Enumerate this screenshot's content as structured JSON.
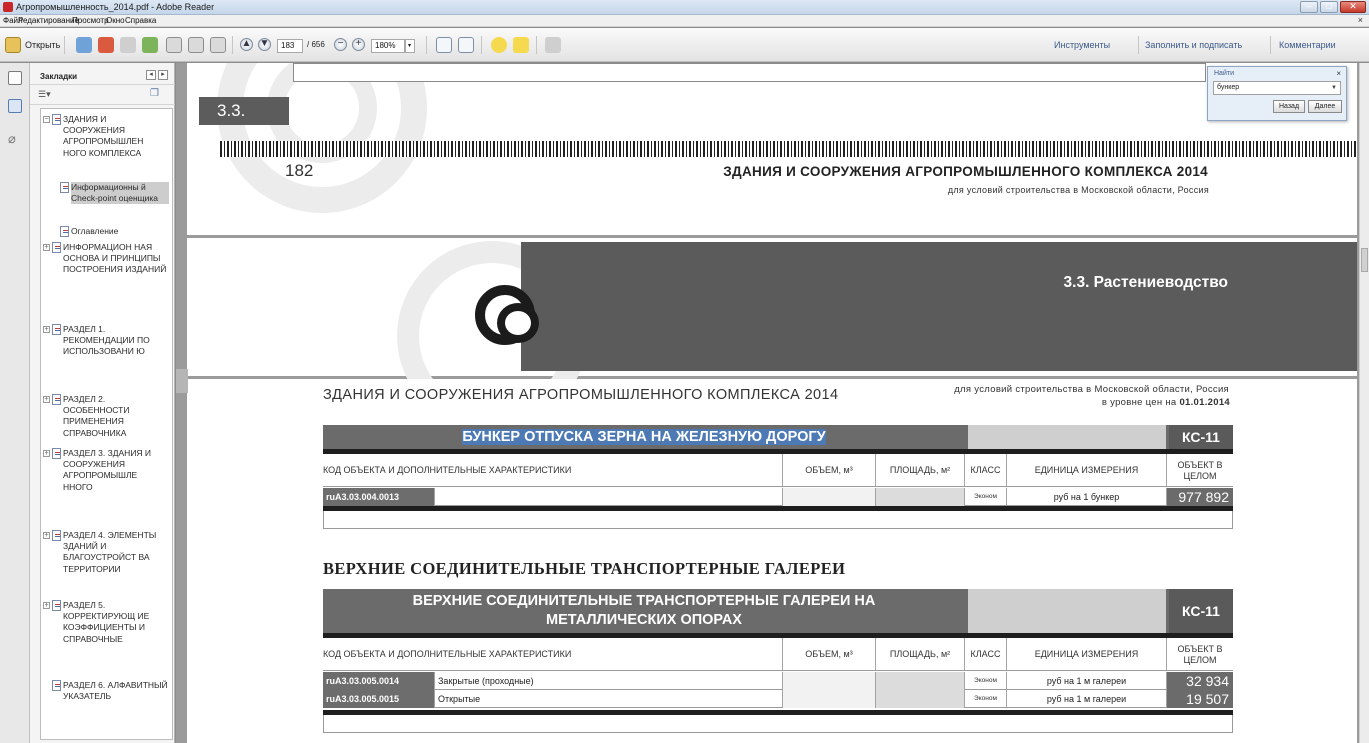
{
  "window": {
    "title": "Агропромышленность_2014.pdf - Adobe Reader"
  },
  "menu": {
    "items": [
      "Файл",
      "Редактирование",
      "Просмотр",
      "Окно",
      "Справка"
    ]
  },
  "toolbar": {
    "open_label": "Открыть",
    "page_current": "183",
    "page_total": "/ 656",
    "zoom": "180%",
    "tools_label": "Инструменты",
    "fill_sign_label": "Заполнить и подписать",
    "comments_label": "Комментарии"
  },
  "bookmarks": {
    "panel_title": "Закладки",
    "items": [
      {
        "label": "ЗДАНИЯ И СООРУЖЕНИЯ АГРОПРОМЫШЛЕН НОГО КОМПЛЕКСА",
        "expander": "−"
      },
      {
        "label": "Информационны й Check-point оценщика",
        "expander": ""
      },
      {
        "label": "Оглавление",
        "expander": ""
      },
      {
        "label": "ИНФОРМАЦИОН НАЯ ОСНОВА И ПРИНЦИПЫ ПОСТРОЕНИЯ ИЗДАНИЙ",
        "expander": "+"
      },
      {
        "label": "РАЗДЕЛ 1. РЕКОМЕНДАЦИИ ПО ИСПОЛЬЗОВАНИ Ю",
        "expander": "+"
      },
      {
        "label": "РАЗДЕЛ 2. ОСОБЕННОСТИ ПРИМЕНЕНИЯ СПРАВОЧНИКА",
        "expander": "+"
      },
      {
        "label": "РАЗДЕЛ 3. ЗДАНИЯ И СООРУЖЕНИЯ АГРОПРОМЫШЛЕ ННОГО",
        "expander": "+"
      },
      {
        "label": "РАЗДЕЛ 4. ЭЛЕМЕНТЫ ЗДАНИЙ И БЛАГОУСТРОЙСТ ВА ТЕРРИТОРИИ",
        "expander": "+"
      },
      {
        "label": "РАЗДЕЛ 5. КОРРЕКТИРУЮЩ ИЕ КОЭФФИЦИЕНТЫ И СПРАВОЧНЫЕ",
        "expander": "+"
      },
      {
        "label": "РАЗДЕЛ 6. АЛФАВИТНЫЙ УКАЗАТЕЛЬ",
        "expander": ""
      }
    ]
  },
  "find": {
    "label": "Найти",
    "value": "бункер",
    "prev_label": "Назад",
    "next_label": "Далее"
  },
  "page1": {
    "section_label": "3.3.",
    "page_number": "182",
    "header_title": "ЗДАНИЯ И СООРУЖЕНИЯ АГРОПРОМЫШЛЕННОГО КОМПЛЕКСА 2014",
    "header_subtitle": "для условий строительства в Московской области, Россия",
    "banner_title": "3.3. Растениеводство"
  },
  "page2": {
    "title": "ЗДАНИЯ И СООРУЖЕНИЯ АГРОПРОМЫШЛЕННОГО КОМПЛЕКСА 2014",
    "subtitle1": "для условий строительства в Московской области, Россия",
    "subtitle2_prefix": "в уровне цен на ",
    "subtitle2_date": "01.01.2014",
    "section_heading": "ВЕРХНИЕ СОЕДИНИТЕЛЬНЫЕ ТРАНСПОРТЕРНЫЕ ГАЛЕРЕИ",
    "columns": {
      "code": "КОД ОБЪЕКТА И ДОПОЛНИТЕЛЬНЫЕ ХАРАКТЕРИСТИКИ",
      "volume": "ОБЪЕМ, м³",
      "area": "ПЛОЩАДЬ, м²",
      "class": "КЛАСС",
      "unit": "ЕДИНИЦА ИЗМЕРЕНИЯ",
      "object": "ОБЪЕКТ В ЦЕЛОМ"
    },
    "table1": {
      "name": "БУНКЕР ОТПУСКА ЗЕРНА НА ЖЕЛЕЗНУЮ ДОРОГУ",
      "code": "КС-11",
      "rows": [
        {
          "code": "ruA3.03.004.0013",
          "desc": "",
          "class": "Эконом",
          "unit": "руб на 1 бункер",
          "value": "977 892"
        }
      ]
    },
    "table2": {
      "name": "ВЕРХНИЕ СОЕДИНИТЕЛЬНЫЕ ТРАНСПОРТЕРНЫЕ ГАЛЕРЕИ НА МЕТАЛЛИЧЕСКИХ ОПОРАХ",
      "code": "КС-11",
      "rows": [
        {
          "code": "ruA3.03.005.0014",
          "desc": "Закрытые (проходные)",
          "class": "Эконом",
          "unit": "руб на 1 м галереи",
          "value": "32 934"
        },
        {
          "code": "ruA3.03.005.0015",
          "desc": "Открытые",
          "class": "Эконом",
          "unit": "руб на 1 м галереи",
          "value": "19 507"
        }
      ]
    }
  }
}
